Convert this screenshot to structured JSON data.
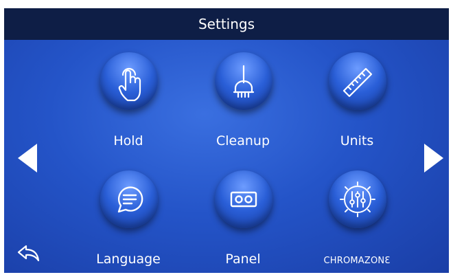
{
  "header": {
    "title": "Settings"
  },
  "nav": {
    "prev_icon": "triangle-left-icon",
    "next_icon": "triangle-right-icon",
    "back_icon": "back-arrow-icon"
  },
  "tiles": [
    {
      "label": "Hold",
      "icon": "hand-touch-icon"
    },
    {
      "label": "Cleanup",
      "icon": "broom-icon"
    },
    {
      "label": "Units",
      "icon": "ruler-icon"
    },
    {
      "label": "Language",
      "icon": "speech-bubble-icon"
    },
    {
      "label": "Panel",
      "icon": "panel-icon"
    },
    {
      "label": "CHROMAZONƐ",
      "icon": "chromazone-sliders-icon"
    }
  ],
  "colors": {
    "title_bar": "#0e1e46",
    "background": "#2454c8",
    "button": "#2a5fd8",
    "text": "#ffffff"
  }
}
